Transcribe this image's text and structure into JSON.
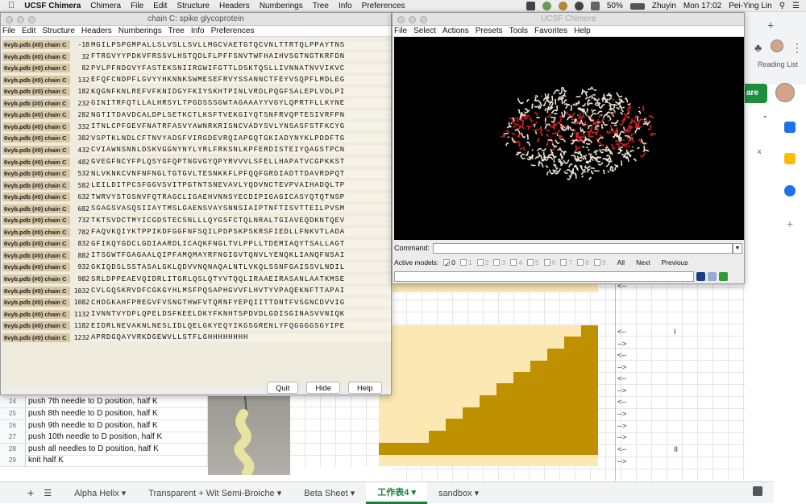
{
  "menubar": {
    "app_name": "UCSF Chimera",
    "items": [
      "Chimera",
      "File",
      "Edit",
      "Structure",
      "Headers",
      "Numberings",
      "Tree",
      "Info",
      "Preferences"
    ],
    "battery": "50%",
    "user_short": "Zhuyin",
    "clock": "Mon 17:02",
    "user_name": "Pei-Ying Lin"
  },
  "seq_window": {
    "title": "chain C: spike glycoprotein",
    "menu": [
      "File",
      "Edit",
      "Structure",
      "Headers",
      "Numberings",
      "Tree",
      "Info",
      "Preferences"
    ],
    "rows": [
      {
        "label": "6vyb.pdb (#0) chain C",
        "num": "-18",
        "seq": "MGILPSPGMPALLSLVSLLSVLLMGCVAETGTQCVNLTTRTQLPPAYTNS"
      },
      {
        "label": "6vyb.pdb (#0) chain C",
        "num": "32",
        "seq": "FTRGVYYPDKVFRSSVLHSTQDLFLPFFSNVTWFHAIHVSGTNGTKRFDN"
      },
      {
        "label": "6vyb.pdb (#0) chain C",
        "num": "82",
        "seq": "PVLPFNDGVYFASTEKSNIIRGWIFGTTLDSKTQSLLIVNNATNVVIKVC"
      },
      {
        "label": "6vyb.pdb (#0) chain C",
        "num": "132",
        "seq": "EFQFCNDPFLGVYYHKNNKSWMESEFRVYSSANNCTFEYVSQPFLMDLEG"
      },
      {
        "label": "6vyb.pdb (#0) chain C",
        "num": "182",
        "seq": "KQGNFKNLREFVFKNIDGYFKIYSKHTPINLVRDLPQGFSALEPLVDLPI"
      },
      {
        "label": "6vyb.pdb (#0) chain C",
        "num": "232",
        "seq": "GINITRFQTLLALHRSYLTPGDSSSGWTAGAAAYYVGYLQPRTFLLKYNE"
      },
      {
        "label": "6vyb.pdb (#0) chain C",
        "num": "282",
        "seq": "NGTITDAVDCALDPLSETKCTLKSFTVEKGIYQTSNFRVQPTESIVRFPN"
      },
      {
        "label": "6vyb.pdb (#0) chain C",
        "num": "332",
        "seq": "ITNLCPFGEVFNATRFASVYAWNRKRISNCVADYSVLYNSASFSTFKCYG"
      },
      {
        "label": "6vyb.pdb (#0) chain C",
        "num": "382",
        "seq": "VSPTKLNDLCFTNVYADSFVIRGDEVRQIAPGQTGKIADYNYKLPDDFTG"
      },
      {
        "label": "6vyb.pdb (#0) chain C",
        "num": "432",
        "seq": "CVIAWNSNNLDSKVGGNYNYLYRLFRKSNLKPFERDISTEIYQAGSTPCN"
      },
      {
        "label": "6vyb.pdb (#0) chain C",
        "num": "482",
        "seq": "GVEGFNCYFPLQSYGFQPTNGVGYQPYRVVVLSFELLHAPATVCGPKKST"
      },
      {
        "label": "6vyb.pdb (#0) chain C",
        "num": "532",
        "seq": "NLVKNKCVNFNFNGLTGTGVLTESNKKFLPFQQFGRDIADTTDAVRDPQT"
      },
      {
        "label": "6vyb.pdb (#0) chain C",
        "num": "582",
        "seq": "LEILDITPCSFGGVSVITPGTNTSNEVAVLYQDVNCTEVPVAIHADQLTP"
      },
      {
        "label": "6vyb.pdb (#0) chain C",
        "num": "632",
        "seq": "TWRVYSTGSNVFQTRAGCLIGAEHVNNSYECDIPIGAGICASYQTQTNSP"
      },
      {
        "label": "6vyb.pdb (#0) chain C",
        "num": "682",
        "seq": "SGAGSVASQSIIAYTMSLGAENSVAYSNNSIAIPTNFTISVTTEILPVSM"
      },
      {
        "label": "6vyb.pdb (#0) chain C",
        "num": "732",
        "seq": "TKTSVDCTMYICGDSTECSNLLLQYGSFCTQLNRALTGIAVEQDKNTQEV"
      },
      {
        "label": "6vyb.pdb (#0) chain C",
        "num": "782",
        "seq": "FAQVKQIYKTPPIKDFGGFNFSQILPDPSKPSKRSFIEDLLFNKVTLADA"
      },
      {
        "label": "6vyb.pdb (#0) chain C",
        "num": "832",
        "seq": "GFIKQYGDCLGDIAARDLICAQKFNGLTVLPPLLTDEMIAQYTSALLAGT"
      },
      {
        "label": "6vyb.pdb (#0) chain C",
        "num": "882",
        "seq": "ITSGWTFGAGAALQIPFAMQMAYRFNGIGVTQNVLYENQKLIANQFNSAI"
      },
      {
        "label": "6vyb.pdb (#0) chain C",
        "num": "932",
        "seq": "GKIQDSLSSTASALGKLQDVVNQNAQALNTLVKQLSSNFGAISSVLNDIL"
      },
      {
        "label": "6vyb.pdb (#0) chain C",
        "num": "982",
        "seq": "SRLDPPEAEVQIDRLITGRLQSLQTYVTQQLIRAAEIRASANLAATKMSE"
      },
      {
        "label": "6vyb.pdb (#0) chain C",
        "num": "1032",
        "seq": "CVLGQSKRVDFCGKGYHLMSFPQSAPHGVVFLHVTYVPAQEKNFTTAPAI"
      },
      {
        "label": "6vyb.pdb (#0) chain C",
        "num": "1082",
        "seq": "CHDGKAHFPREGVFVSNGTHWFVTQRNFYEPQIITTDNTFVSGNCDVVIG"
      },
      {
        "label": "6vyb.pdb (#0) chain C",
        "num": "1132",
        "seq": "IVNNTVYDPLQPELDSFKEELDKYFKNHTSPDVDLGDISGINASVVNIQK"
      },
      {
        "label": "6vyb.pdb (#0) chain C",
        "num": "1182",
        "seq": "EIDRLNEVAKNLNESLIDLQELGKYEQYIKGSGRENLYFQGGGGSGYIPE"
      },
      {
        "label": "6vyb.pdb (#0) chain C",
        "num": "1232",
        "seq": "APRDGQAYVRKDGEWVLLSTFLGHHHHHHHH"
      }
    ],
    "buttons": {
      "quit": "Quit",
      "hide": "Hide",
      "help": "Help"
    }
  },
  "chimera_window": {
    "title": "UCSF Chimera",
    "menu": [
      "File",
      "Select",
      "Actions",
      "Presets",
      "Tools",
      "Favorites",
      "Help"
    ],
    "command_label": "Command:",
    "active_models_label": "Active models:",
    "model_ids": [
      "0",
      "1",
      "2",
      "3",
      "4",
      "5",
      "6",
      "7",
      "8",
      "9"
    ],
    "all": "All",
    "next": "Next",
    "previous": "Previous",
    "colors": {
      "red": "#d42020",
      "bone": "#e8e2cf"
    }
  },
  "sheet": {
    "rows": [
      {
        "n": "24",
        "text": "push 7th needle to D position, half K",
        "arrow": "-->"
      },
      {
        "n": "25",
        "text": "push 8th needle to D position, half K",
        "arrow": "-->"
      },
      {
        "n": "26",
        "text": "push 9th needle to D position, half K",
        "arrow": "-->"
      },
      {
        "n": "27",
        "text": "push 10th needle to D position, half K",
        "arrow": "-->"
      },
      {
        "n": "28",
        "text": "push all needles to D position, half K",
        "arrow": "<--",
        "mark": "II"
      },
      {
        "n": "29",
        "text": "knit half K",
        "arrow": "-->"
      }
    ],
    "upper_arrows": [
      "<--",
      "<--",
      "-->",
      "<--",
      "-->",
      "<--",
      "-->",
      "<--"
    ],
    "upper_mark": "I",
    "tabs": [
      "Alpha Helix",
      "Transparent + Wit Semi-Broiche",
      "Beta Sheet",
      "工作表4",
      "sandbox"
    ],
    "share_label": "are",
    "reading_list": "Reading List",
    "colors": {
      "light": "#fce8b2",
      "dark": "#bf9000",
      "green": "#188038"
    }
  }
}
